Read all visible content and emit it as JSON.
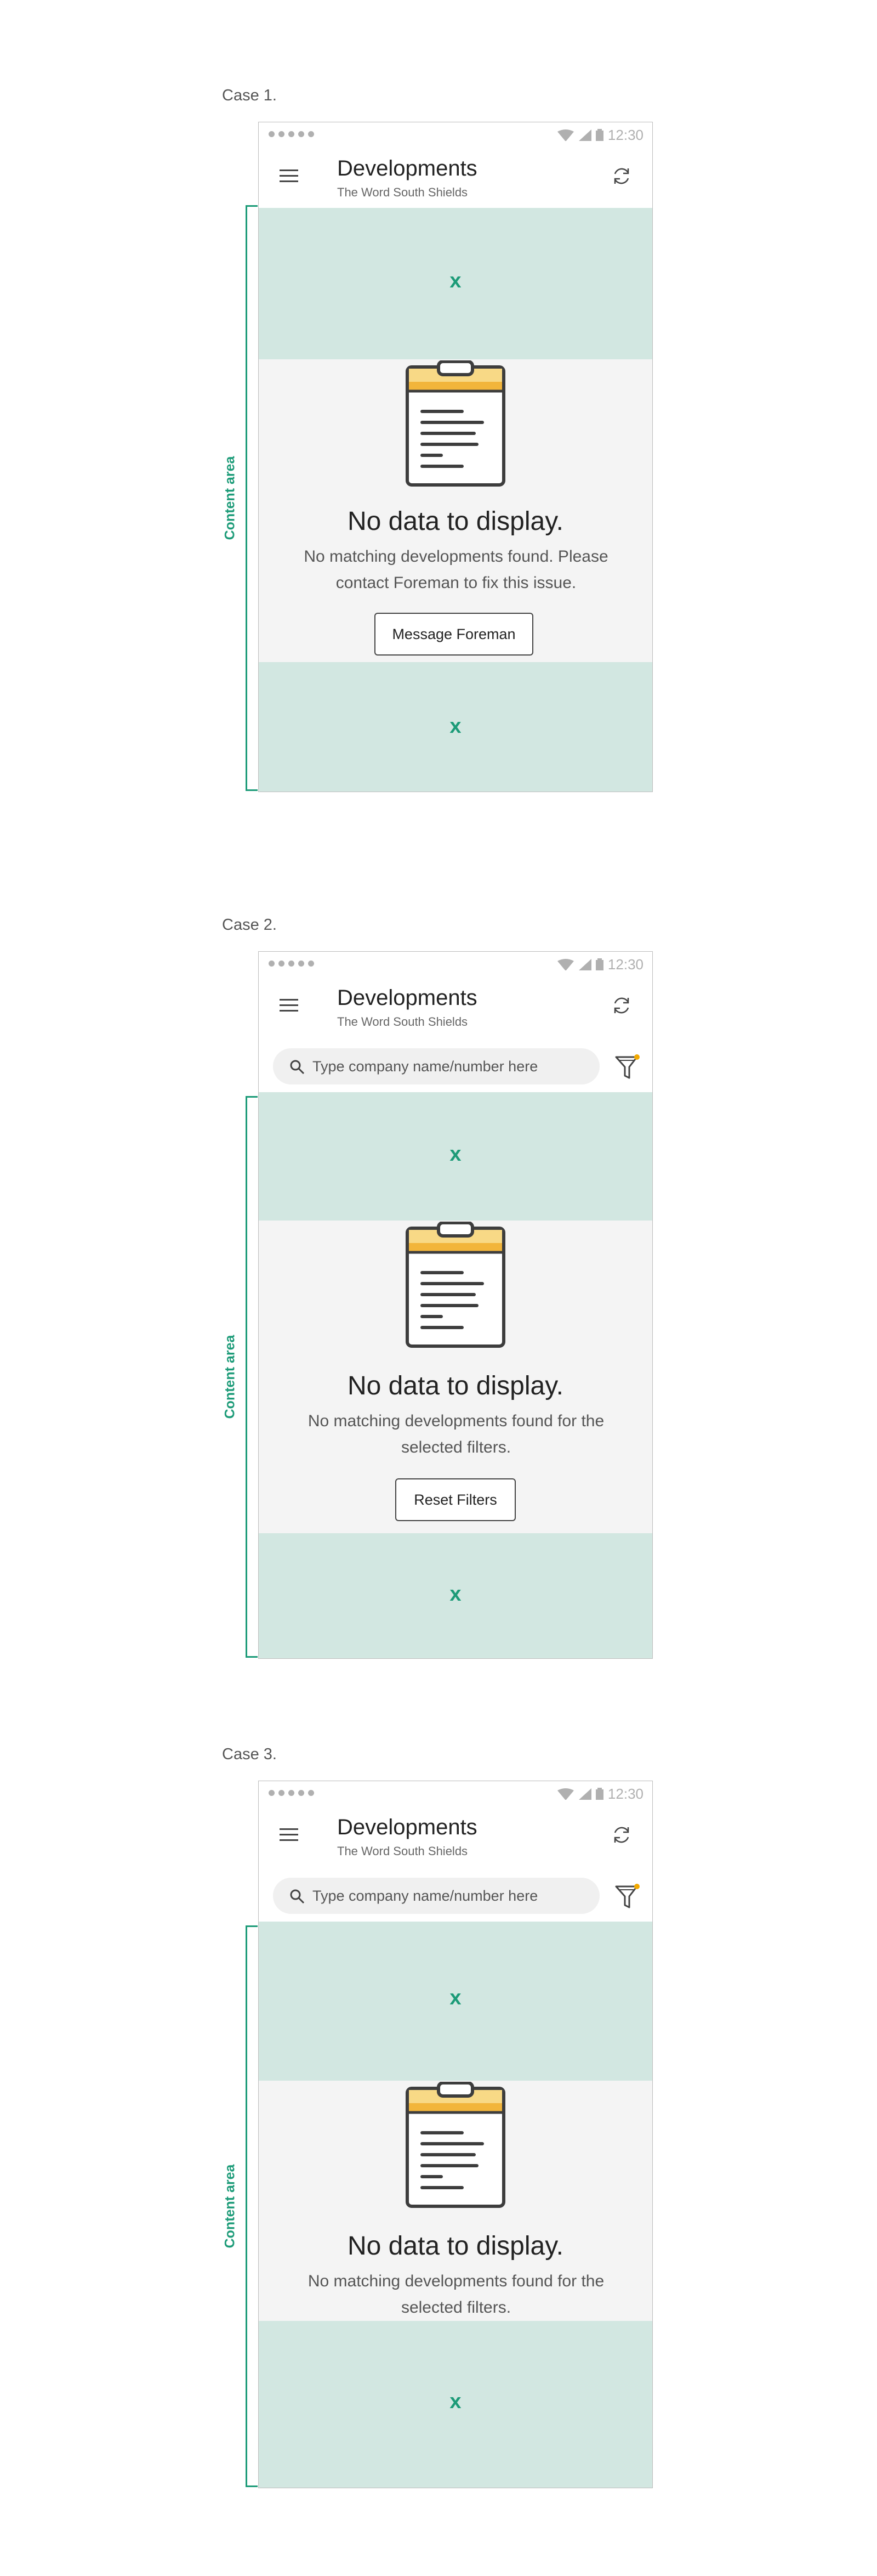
{
  "cases": [
    {
      "label": "Case 1.",
      "status_time": "12:30",
      "title": "Developments",
      "subtitle": "The Word South Shields",
      "placeholder_x_top": "x",
      "placeholder_x_bottom": "x",
      "empty_title": "No data to display.",
      "empty_message": "No matching developments found. Please contact Foreman to fix this issue.",
      "button_label": "Message Foreman",
      "content_area_label": "Content area"
    },
    {
      "label": "Case 2.",
      "status_time": "12:30",
      "title": "Developments",
      "subtitle": "The Word South Shields",
      "search_placeholder": "Type company name/number here",
      "placeholder_x_top": "x",
      "placeholder_x_bottom": "x",
      "empty_title": "No data to display.",
      "empty_message": "No matching developments found for the selected filters.",
      "button_label": "Reset Filters",
      "content_area_label": "Content area"
    },
    {
      "label": "Case 3.",
      "status_time": "12:30",
      "title": "Developments",
      "subtitle": "The Word South Shields",
      "search_placeholder": "Type company name/number here",
      "placeholder_x_top": "x",
      "placeholder_x_bottom": "x",
      "empty_title": "No data to display.",
      "empty_message": "No matching developments found for the selected filters.",
      "content_area_label": "Content area"
    }
  ],
  "colors": {
    "band": "#d2e7e1",
    "accent": "#1c9b78",
    "clipboard_top": "#f8d986",
    "clipboard_band": "#f2b53b",
    "filter_dot": "#f2a900"
  },
  "icons": [
    "menu-icon",
    "refresh-icon",
    "search-icon",
    "filter-icon",
    "clipboard-icon",
    "wifi-icon",
    "signal-icon",
    "battery-icon"
  ]
}
